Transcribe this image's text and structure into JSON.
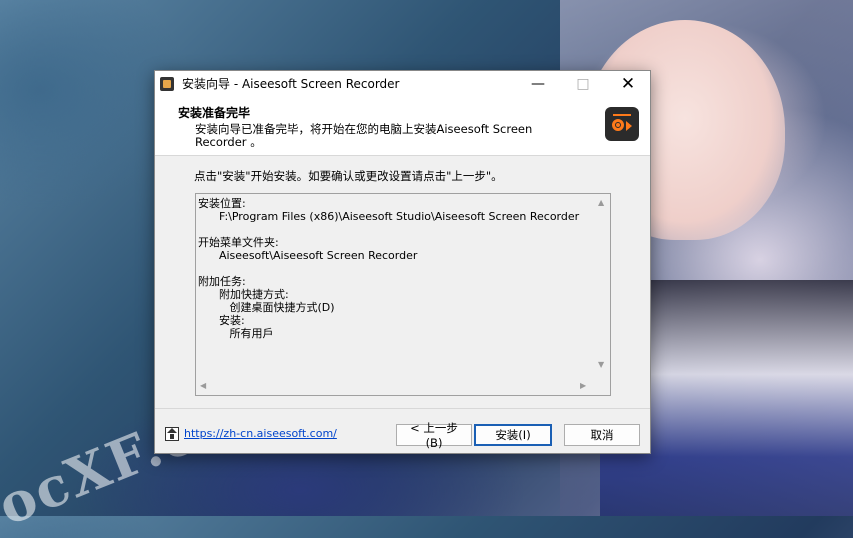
{
  "window": {
    "title": "安装向导 - Aiseesoft Screen Recorder"
  },
  "header": {
    "title": "安装准备完毕",
    "description": "安装向导已准备完毕，将开始在您的电脑上安装Aiseesoft Screen Recorder 。"
  },
  "instruction": "点击\"安装\"开始安装。如要确认或更改设置请点击\"上一步\"。",
  "summary": {
    "lines": [
      "安装位置:",
      "      F:\\Program Files (x86)\\Aiseesoft Studio\\Aiseesoft Screen Recorder",
      "",
      "开始菜单文件夹:",
      "      Aiseesoft\\Aiseesoft Screen Recorder",
      "",
      "附加任务:",
      "      附加快捷方式:",
      "         创建桌面快捷方式(D)",
      "      安装:",
      "         所有用戶"
    ]
  },
  "footer": {
    "link": "https://zh-cn.aiseesoft.com/",
    "back_button": "< 上一步(B)",
    "install_button": "安装(I)",
    "cancel_button": "取消"
  },
  "wallpaper": {
    "watermark": "ocXF.co"
  }
}
